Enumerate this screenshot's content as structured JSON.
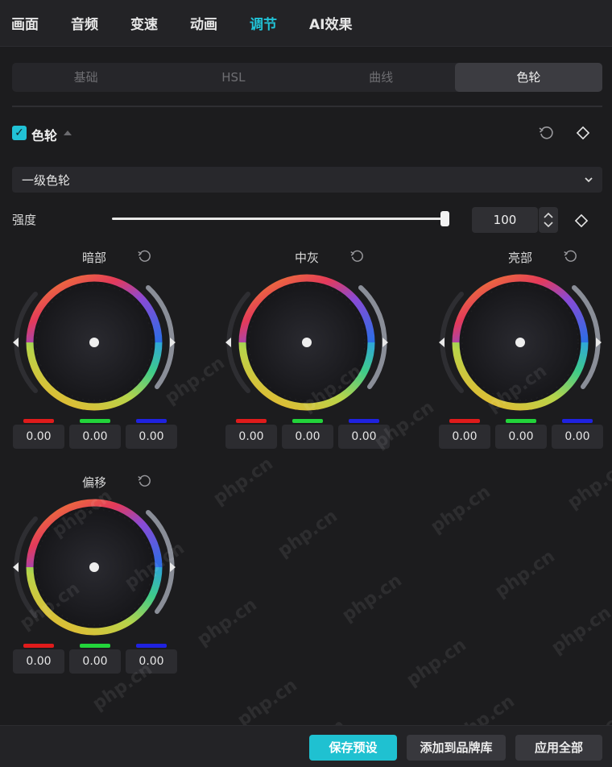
{
  "top_tabs": [
    "画面",
    "音频",
    "变速",
    "动画",
    "调节",
    "AI效果"
  ],
  "active_top_tab": "调节",
  "sub_tabs": [
    "基础",
    "HSL",
    "曲线",
    "色轮"
  ],
  "active_sub_tab": "色轮",
  "section": {
    "title": "色轮",
    "checked": true,
    "checkmark": "✓"
  },
  "wheel_type": {
    "selected": "一级色轮"
  },
  "intensity": {
    "label": "强度",
    "value": "100",
    "level": 1.0
  },
  "wheels": [
    {
      "title": "暗部",
      "r": "0.00",
      "g": "0.00",
      "b": "0.00"
    },
    {
      "title": "中灰",
      "r": "0.00",
      "g": "0.00",
      "b": "0.00"
    },
    {
      "title": "亮部",
      "r": "0.00",
      "g": "0.00",
      "b": "0.00"
    },
    {
      "title": "偏移",
      "r": "0.00",
      "g": "0.00",
      "b": "0.00"
    }
  ],
  "buttons": {
    "save_preset": "保存预设",
    "add_brand": "添加到品牌库",
    "apply_all": "应用全部"
  },
  "watermark": "php.cn",
  "colors": {
    "accent": "#21c2d6",
    "red_channel": "#e01b1b",
    "green_channel": "#22d43a",
    "blue_channel": "#1f22e0"
  },
  "icons": {
    "reset": "reset-icon",
    "keyframe": "keyframe-diamond-icon",
    "chevron": "chevron-down-icon",
    "stepper": "stepper-arrows-icon"
  }
}
